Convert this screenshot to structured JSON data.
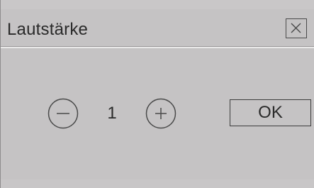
{
  "dialog": {
    "title": "Lautstärke",
    "close_icon": "close-icon",
    "volume_value": "1",
    "decrease_icon": "minus-circle-icon",
    "increase_icon": "plus-circle-icon",
    "ok_label": "OK"
  },
  "colors": {
    "background": "#c5c3c4",
    "text": "#2a2a2a",
    "border": "#4a4a4a",
    "divider_light": "#e9e8e8"
  }
}
